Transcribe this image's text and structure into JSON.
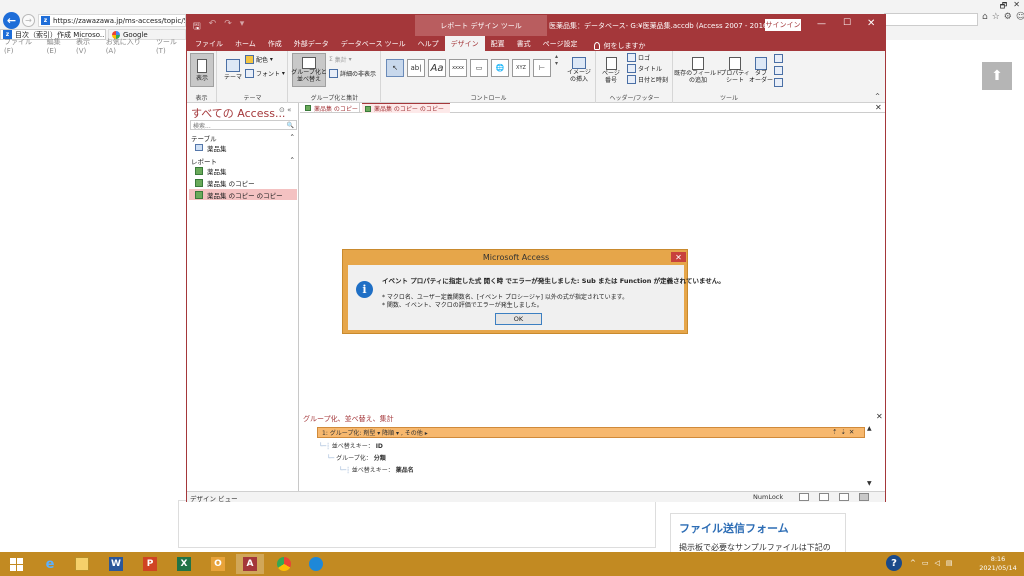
{
  "browser": {
    "address": "https://zawazawa.jp/ms-access/topic/564",
    "tabs": [
      {
        "label": "目次（索引）作成 Microso..."
      },
      {
        "label": "Google"
      }
    ],
    "menu": [
      "ファイル(F)",
      "編集(E)",
      "表示(V)",
      "お気に入り(A)",
      "ツール(T)"
    ],
    "favicon_letter": "z"
  },
  "webpage": {
    "card_title": "ファイル送信フォーム",
    "card_text": "掲示板で必要なサンプルファイルは下記の"
  },
  "access": {
    "tool_context": "レポート デザイン ツール",
    "window_title": "医薬品集：データベース- G:¥医薬品集.accdb (Access 2007 - 2016 ファイ...",
    "signin": "サインイン",
    "tabs": [
      "ファイル",
      "ホーム",
      "作成",
      "外部データ",
      "データベース ツール",
      "ヘルプ",
      "デザイン",
      "配置",
      "書式",
      "ページ設定"
    ],
    "active_tab_index": 6,
    "tellme": "何をしますか",
    "ribbon": {
      "view_btn": "表示",
      "theme_btn": "テーマ",
      "colors_btn": "配色",
      "fonts_btn": "フォント",
      "group_sort_btn_line1": "グループ化と",
      "group_sort_btn_line2": "並べ替え",
      "totals_btn": "集計",
      "hide_details_btn": "詳細の非表示",
      "image_btn_line1": "イメージ",
      "image_btn_line2": "の挿入",
      "page_num_line1": "ページ",
      "page_num_line2": "番号",
      "logo_btn": "ロゴ",
      "title_btn": "タイトル",
      "datetime_btn": "日付と時刻",
      "add_fields_line1": "既存のフィールド",
      "add_fields_line2": "の追加",
      "property_line1": "プロパティ",
      "property_line2": "シート",
      "taborder_line1": "タブ",
      "taborder_line2": "オーダー",
      "groups": [
        "表示",
        "テーマ",
        "グループ化と集計",
        "コントロール",
        "ヘッダー/フッター",
        "ツール"
      ]
    },
    "nav": {
      "header": "すべての Access...",
      "search_placeholder": "検索...",
      "section_tables": "テーブル",
      "section_reports": "レポート",
      "tables": [
        "薬品集"
      ],
      "reports": [
        "薬品集",
        "薬品集 のコピー",
        "薬品集 のコピー のコピー"
      ],
      "selected_report_index": 2
    },
    "doc_tabs": [
      "薬品集 のコピー",
      "薬品集 のコピー のコピー"
    ],
    "group_pane": {
      "title": "グループ化、並べ替え、集計",
      "row1": "1: グループ化: 剤型 ▾  降順 ▾ , その他 ▸",
      "row2_label": "並べ替えキー：",
      "row2_value": "ID",
      "row3_label": "グループ化：",
      "row3_value": "分類",
      "row4_label": "並べ替えキー：",
      "row4_value": "薬品名"
    },
    "status": {
      "left": "デザイン ビュー",
      "numlock": "NumLock"
    }
  },
  "dialog": {
    "title": "Microsoft Access",
    "message": "イベント プロパティに指定した式 開く時 でエラーが発生しました: Sub または Function が定義されていません。",
    "bullet1": "* マクロ名、ユーザー定義関数名、[イベント プロシージャ] 以外の式が指定されています。",
    "bullet2": "* 関数、イベント、マクロの評価でエラーが発生しました。",
    "ok": "OK"
  },
  "taskbar": {
    "time": "8:16",
    "date": "2021/05/14",
    "apps": [
      "ie-icon",
      "explorer-icon",
      "word-icon",
      "powerpoint-icon",
      "excel-icon",
      "outlook-icon",
      "access-icon",
      "chrome-icon",
      "edge-icon"
    ]
  }
}
